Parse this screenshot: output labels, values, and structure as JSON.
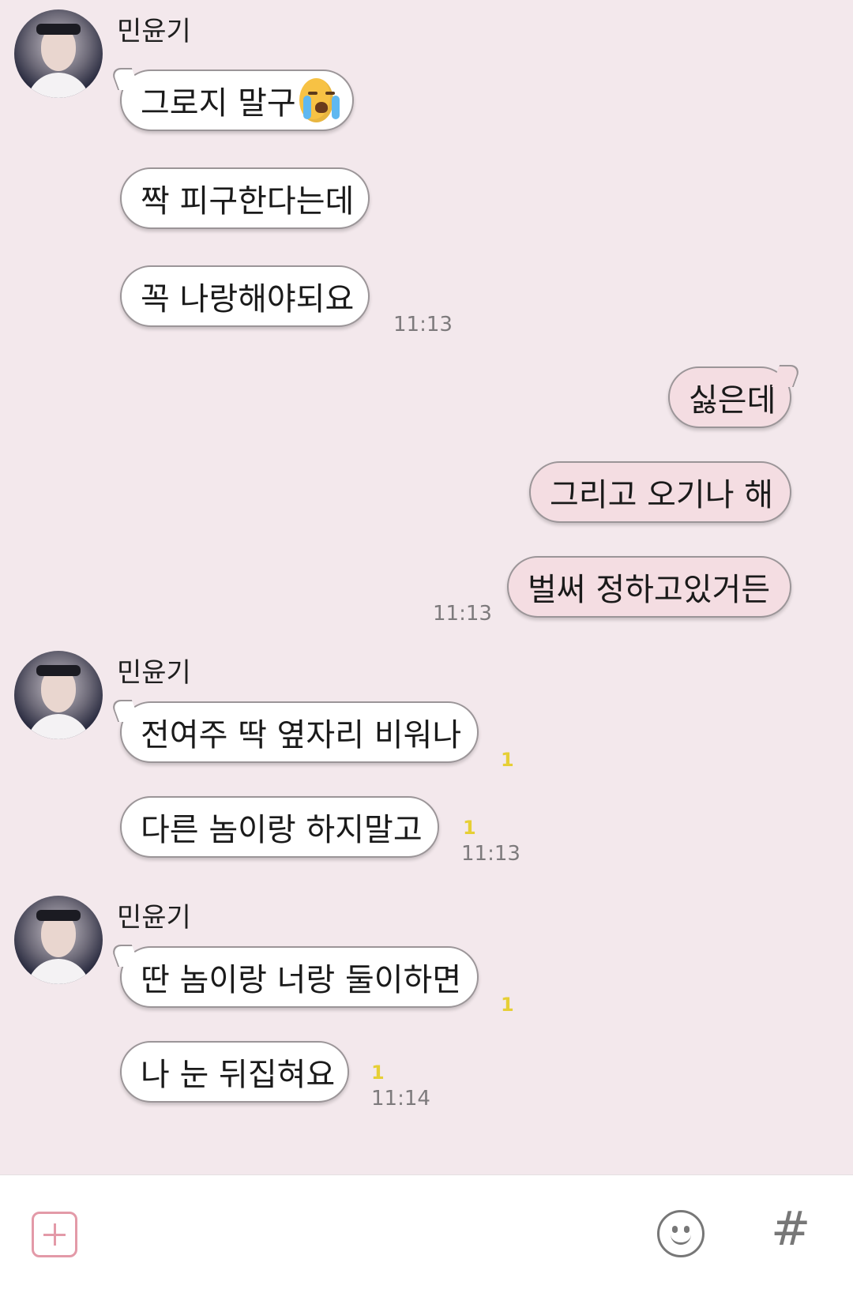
{
  "colors": {
    "background": "#f3e8ec",
    "incoming_bubble": "#ffffff",
    "outgoing_bubble": "#f4dde2",
    "unread_count": "#e6cf35",
    "plus_accent": "#e39aa8"
  },
  "group1": {
    "sender": "민윤기",
    "messages": [
      "그로지 말구",
      "짝 피구한다는데",
      "꼭 나랑해야되요"
    ],
    "emoji_icon": "loudly-crying-face",
    "time": "11:13"
  },
  "outgoing": {
    "messages": [
      "싫은데",
      "그리고 오기나 해",
      "벌써 정하고있거든"
    ],
    "time": "11:13"
  },
  "group2": {
    "sender": "민윤기",
    "messages": [
      "전여주 딱 옆자리 비워나",
      "다른 놈이랑 하지말고"
    ],
    "unread": [
      "1",
      "1"
    ],
    "time": "11:13"
  },
  "group3": {
    "sender": "민윤기",
    "messages": [
      "딴 놈이랑 너랑 둘이하면",
      "나 눈 뒤집혀요"
    ],
    "unread": [
      "1",
      "1"
    ],
    "time": "11:14"
  },
  "input_bar": {
    "icons": [
      "plus-icon",
      "emoticon-icon",
      "hashtag-icon"
    ],
    "hashtag_label": "#"
  }
}
